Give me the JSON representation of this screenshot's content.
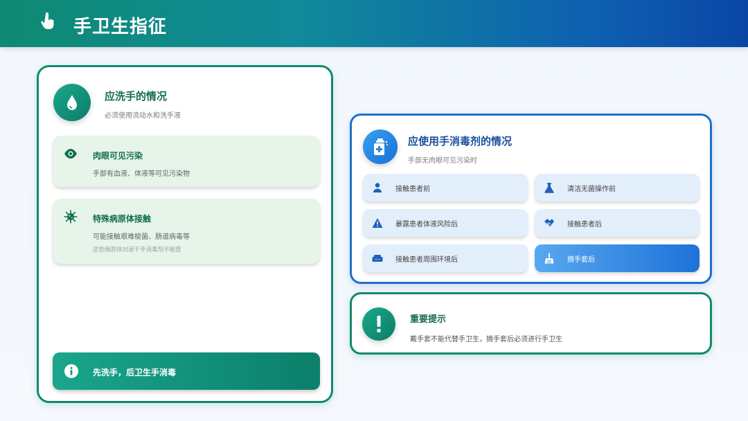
{
  "header": {
    "title": "手卫生指征",
    "icon": "pointing-hand-icon"
  },
  "handwash": {
    "title": "应洗手的情况",
    "subtitle": "必须使用流动水和洗手液",
    "icon": "water-drop-icon",
    "cards": [
      {
        "icon": "eye-icon",
        "title": "肉眼可见污染",
        "desc": "手部有血液、体液等可见污染物"
      },
      {
        "icon": "virus-icon",
        "title": "特殊病原体接触",
        "desc": "可能接触艰难梭菌、肠道病毒等",
        "note": "这些病原体对速干手消毒剂不敏感"
      }
    ],
    "tip": {
      "icon": "info-icon",
      "text": "先洗手，后卫生手消毒"
    }
  },
  "sanitizer": {
    "title": "应使用手消毒剂的情况",
    "subtitle": "手部无肉眼可见污染时",
    "icon": "sanitizer-bottle-icon",
    "items": [
      {
        "icon": "user-icon",
        "label": "接触患者前"
      },
      {
        "icon": "flask-icon",
        "label": "清洁无菌操作前"
      },
      {
        "icon": "warning-icon",
        "label": "暴露患者体液风险后"
      },
      {
        "icon": "handshake-icon",
        "label": "接触患者后"
      },
      {
        "icon": "couch-icon",
        "label": "接触患者周围环境后"
      },
      {
        "icon": "broom-icon",
        "label": "摘手套后"
      }
    ]
  },
  "notice": {
    "icon": "exclamation-icon",
    "title": "重要提示",
    "text": "戴手套不能代替手卫生，摘手套后必须进行手卫生"
  },
  "colors": {
    "green": "#0f8a6e",
    "blue": "#1e6fcc",
    "green_card": "#e6f4ea",
    "blue_pill": "#e3eefb"
  }
}
